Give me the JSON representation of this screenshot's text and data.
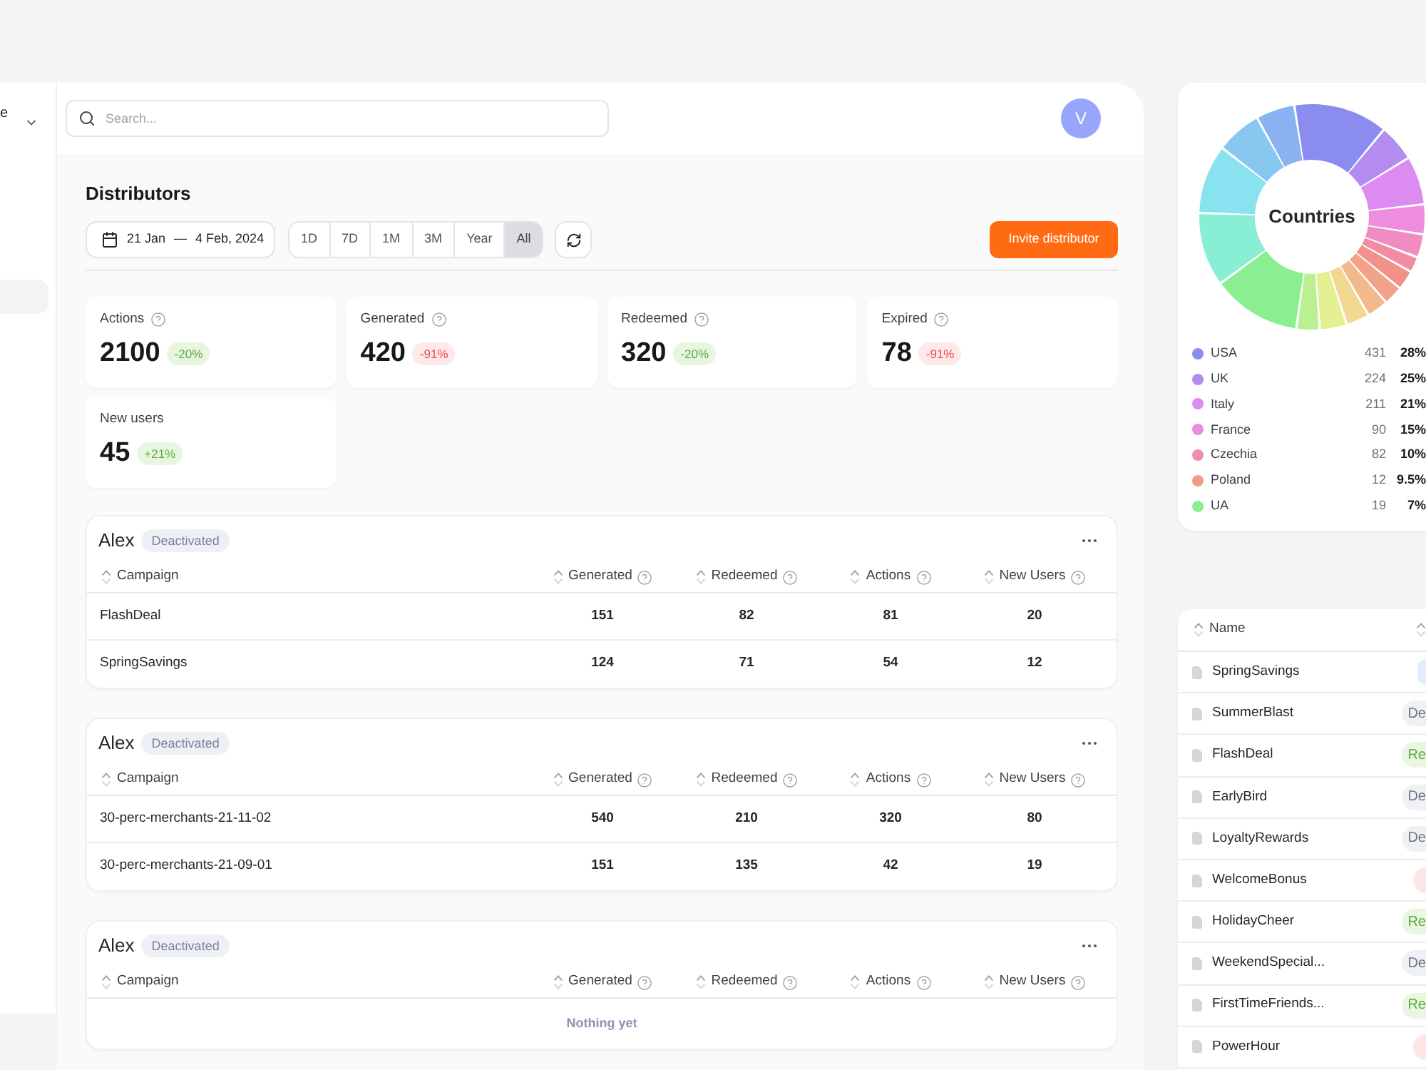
{
  "sidebar": {
    "label": "e",
    "nav_items": [
      {
        "selected": true
      }
    ]
  },
  "search": {
    "placeholder": "Search..."
  },
  "avatar": {
    "initial": "V"
  },
  "page_title": "Distributors",
  "date_range": {
    "start": "21 Jan",
    "separator": "—",
    "end": "4 Feb, 2024"
  },
  "periods": [
    {
      "label": "1D",
      "selected": false
    },
    {
      "label": "7D",
      "selected": false
    },
    {
      "label": "1M",
      "selected": false
    },
    {
      "label": "3M",
      "selected": false
    },
    {
      "label": "Year",
      "selected": false
    },
    {
      "label": "All",
      "selected": true
    }
  ],
  "invite_button": "Invite distributor",
  "stats": [
    {
      "label": "Actions",
      "help": true,
      "value": "2100",
      "change": "-20%",
      "kind": "positive"
    },
    {
      "label": "Generated",
      "help": true,
      "value": "420",
      "change": "-91%",
      "kind": "negative"
    },
    {
      "label": "Redeemed",
      "help": true,
      "value": "320",
      "change": "-20%",
      "kind": "positive"
    },
    {
      "label": "Expired",
      "help": true,
      "value": "78",
      "change": "-91%",
      "kind": "negative"
    },
    {
      "label": "New users",
      "help": false,
      "value": "45",
      "change": "+21%",
      "kind": "positive"
    }
  ],
  "distributors": [
    {
      "name": "Alex",
      "status": "Deactivated",
      "columns": [
        {
          "label": "Campaign",
          "help": false
        },
        {
          "label": "Generated",
          "help": true
        },
        {
          "label": "Redeemed",
          "help": true
        },
        {
          "label": "Actions",
          "help": true
        },
        {
          "label": "New Users",
          "help": true
        }
      ],
      "rows": [
        {
          "cells": [
            "FlashDeal",
            "151",
            "82",
            "81",
            "20"
          ]
        },
        {
          "cells": [
            "SpringSavings",
            "124",
            "71",
            "54",
            "12"
          ]
        }
      ]
    },
    {
      "name": "Alex",
      "status": "Deactivated",
      "columns": [
        {
          "label": "Campaign",
          "help": false
        },
        {
          "label": "Generated",
          "help": true
        },
        {
          "label": "Redeemed",
          "help": true
        },
        {
          "label": "Actions",
          "help": true
        },
        {
          "label": "New Users",
          "help": true
        }
      ],
      "rows": [
        {
          "cells": [
            "30-perc-merchants-21-11-02",
            "540",
            "210",
            "320",
            "80"
          ]
        },
        {
          "cells": [
            "30-perc-merchants-21-09-01",
            "151",
            "135",
            "42",
            "19"
          ]
        }
      ]
    },
    {
      "name": "Alex",
      "status": "Deactivated",
      "columns": [
        {
          "label": "Campaign",
          "help": false
        },
        {
          "label": "Generated",
          "help": true
        },
        {
          "label": "Redeemed",
          "help": true
        },
        {
          "label": "Actions",
          "help": true
        },
        {
          "label": "New Users",
          "help": true
        }
      ],
      "empty_text": "Nothing yet"
    }
  ],
  "countries": {
    "title": "Countries",
    "legend": [
      {
        "name": "USA",
        "count": "431",
        "share": "28%",
        "color": "#8a8cf0"
      },
      {
        "name": "UK",
        "count": "224",
        "share": "25%",
        "color": "#b48cf0"
      },
      {
        "name": "Italy",
        "count": "211",
        "share": "21%",
        "color": "#dc8cf0"
      },
      {
        "name": "France",
        "count": "90",
        "share": "15%",
        "color": "#ee8cdc"
      },
      {
        "name": "Czechia",
        "count": "82",
        "share": "10%",
        "color": "#f08cb0"
      },
      {
        "name": "Poland",
        "count": "12",
        "share": "9.5%",
        "color": "#f29a88"
      },
      {
        "name": "UA",
        "count": "19",
        "share": "7%",
        "color": "#8cee90"
      }
    ]
  },
  "campaigns": {
    "columns": [
      "Name"
    ],
    "rows": [
      {
        "name": "SpringSavings",
        "badge": {
          "kind": "info"
        }
      },
      {
        "name": "SummerBlast",
        "badge": {
          "kind": "neutral",
          "text": "De"
        }
      },
      {
        "name": "FlashDeal",
        "badge": {
          "kind": "success",
          "text": "Re"
        }
      },
      {
        "name": "EarlyBird",
        "badge": {
          "kind": "neutral",
          "text": "De"
        }
      },
      {
        "name": "LoyaltyRewards",
        "badge": {
          "kind": "neutral",
          "text": "De"
        }
      },
      {
        "name": "WelcomeBonus",
        "badge": {
          "kind": "danger"
        }
      },
      {
        "name": "HolidayCheer",
        "badge": {
          "kind": "success",
          "text": "Re"
        }
      },
      {
        "name": "WeekendSpecial...",
        "badge": {
          "kind": "neutral",
          "text": "De"
        }
      },
      {
        "name": "FirstTimeFriends...",
        "badge": {
          "kind": "success",
          "text": "Re"
        }
      },
      {
        "name": "PowerHour",
        "badge": {
          "kind": "danger"
        }
      }
    ]
  }
}
